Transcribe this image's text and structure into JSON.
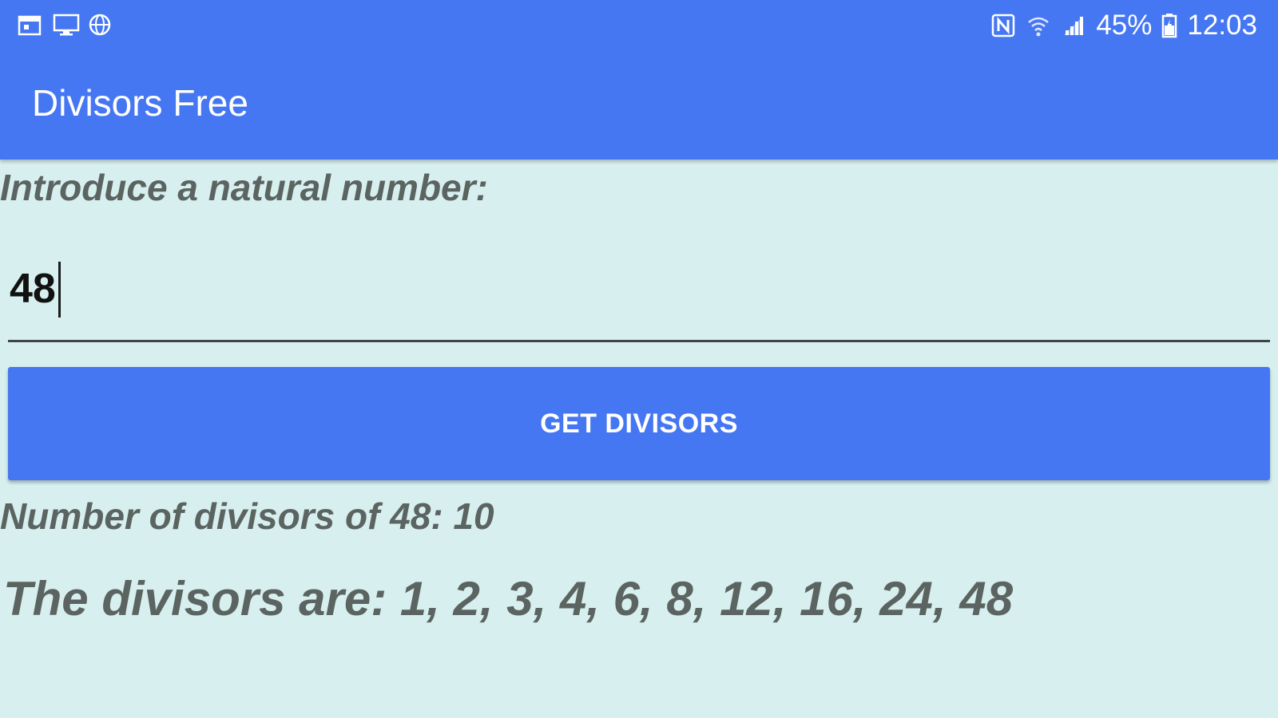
{
  "status_bar": {
    "left_icons": [
      "calendar-icon",
      "monitor-icon",
      "globe-icon"
    ],
    "right_icons": [
      "nfc-icon",
      "wifi-icon",
      "signal-icon",
      "battery-icon"
    ],
    "battery_text": "45%",
    "time": "12:03"
  },
  "app_bar": {
    "title": "Divisors Free"
  },
  "form": {
    "prompt": "Introduce a natural number:",
    "number_value": "48",
    "button_label": "GET DIVISORS"
  },
  "result": {
    "count_text": "Number of divisors of 48: 10",
    "divisors_text": "The divisors are: 1, 2, 3, 4, 6, 8, 12, 16, 24, 48"
  },
  "colors": {
    "primary": "#4677f3",
    "background": "#d7f0ef",
    "text_muted": "#5b6461"
  }
}
